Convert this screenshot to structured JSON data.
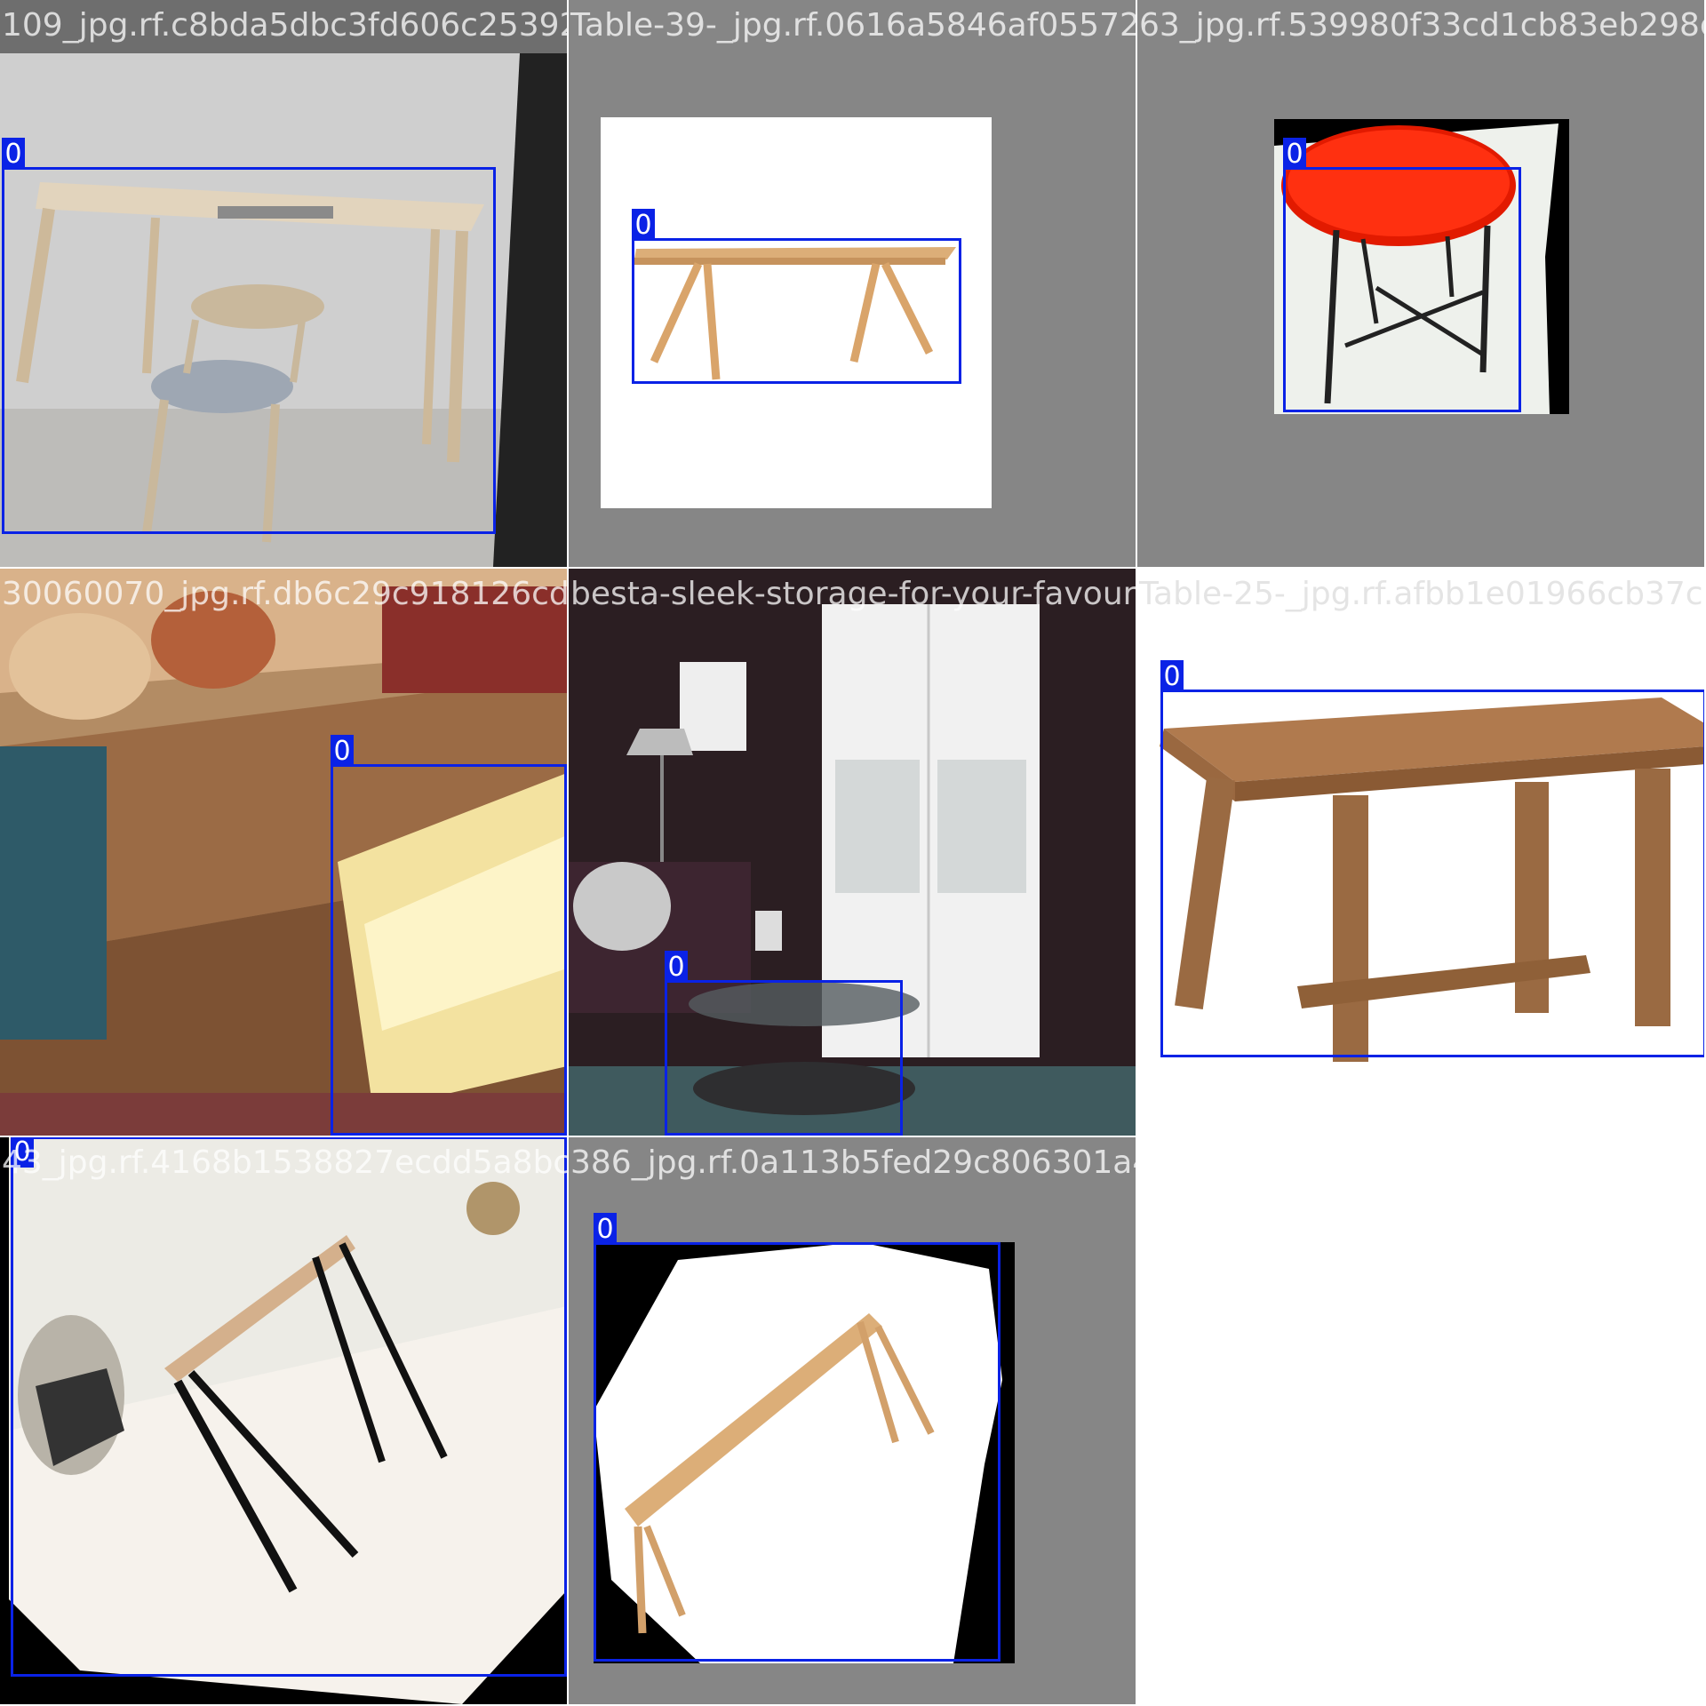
{
  "tiles": [
    {
      "filename": "109_jpg.rf.c8bda5dbc3fd606c253925dc237f39",
      "class_label": "0"
    },
    {
      "filename": "Table-39-_jpg.rf.0616a5846af05572823a1e97",
      "class_label": "0"
    },
    {
      "filename": "63_jpg.rf.539980f33cd1cb83eb298cbb",
      "class_label": "0"
    },
    {
      "filename": "30060070_jpg.rf.db6c29c918126cd4c8ee2307",
      "class_label": "0"
    },
    {
      "filename": "besta-sleek-storage-for-your-favourite-th",
      "class_label": "0"
    },
    {
      "filename": "Table-25-_jpg.rf.afbb1e01966cb37c1e",
      "class_label": "0"
    },
    {
      "filename": "43_jpg.rf.4168b1538827ecdd5a8bc25",
      "class_label": "0"
    },
    {
      "filename": "386_jpg.rf.0a113b5fed29c806301a43459c872e",
      "class_label": "0"
    }
  ],
  "colors": {
    "box": "#0a22e6",
    "tile_bg": "#868686"
  }
}
